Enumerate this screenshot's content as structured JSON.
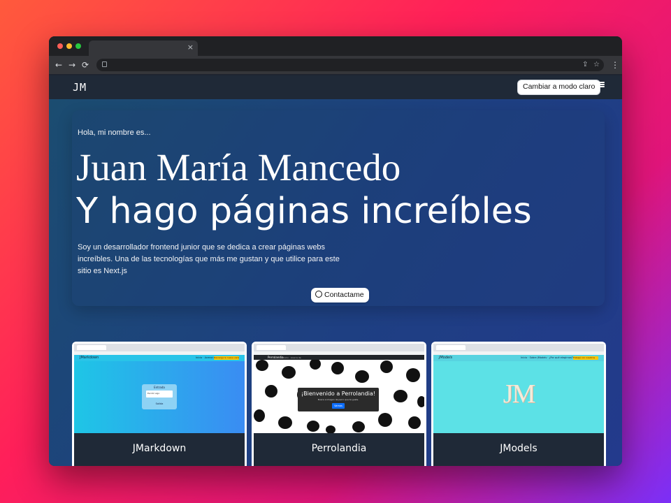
{
  "browser": {
    "tab_close": "×",
    "back_icon": "←",
    "forward_icon": "→",
    "reload_icon": "⟳",
    "share_icon": "⇪",
    "star_icon": "☆",
    "menu_icon": "⋮"
  },
  "nav": {
    "logo": "JM",
    "mode_button": "Cambiar a modo claro"
  },
  "hero": {
    "greeting": "Hola, mi nombre es...",
    "name": "Juan María Mancedo",
    "tagline": "Y hago páginas increíbles",
    "description": "Soy un desarrollador frontend junior que se dedica a crear páginas webs increíbles. Una de las tecnologías que más me gustan y que utilice para este sitio es Next.js",
    "contact_button": "Contactame"
  },
  "projects": [
    {
      "title": "JMarkdown",
      "preview": {
        "site_name": "JMarkdown",
        "nav_links": "Inicio · Acerca de",
        "nav_button": "Descarga la nueva versión",
        "dialog_title": "Entrada",
        "dialog_text": "Escribí algo",
        "dialog_footer": "Salida"
      }
    },
    {
      "title": "Perrolandia",
      "preview": {
        "site_name": "Perrolandia",
        "nav_links": "Inicio · Acerca de",
        "heading": "¡Bienvenido a Perrolandia!",
        "subtext": "Busca a imagen de perro que te guste.",
        "button": "Vamos"
      }
    },
    {
      "title": "JModels",
      "preview": {
        "site_name": "JModels",
        "nav_links": "Inicio · Sobre JModels · ¿Por qué elegirnos?",
        "nav_button": "Trabajá con nosotros",
        "logo_text": "JM"
      }
    }
  ],
  "colors": {
    "page_gradient_start": "#1b4c70",
    "page_gradient_end": "#233a8c",
    "navbar": "#1f2937",
    "card_footer": "#1f2937"
  }
}
